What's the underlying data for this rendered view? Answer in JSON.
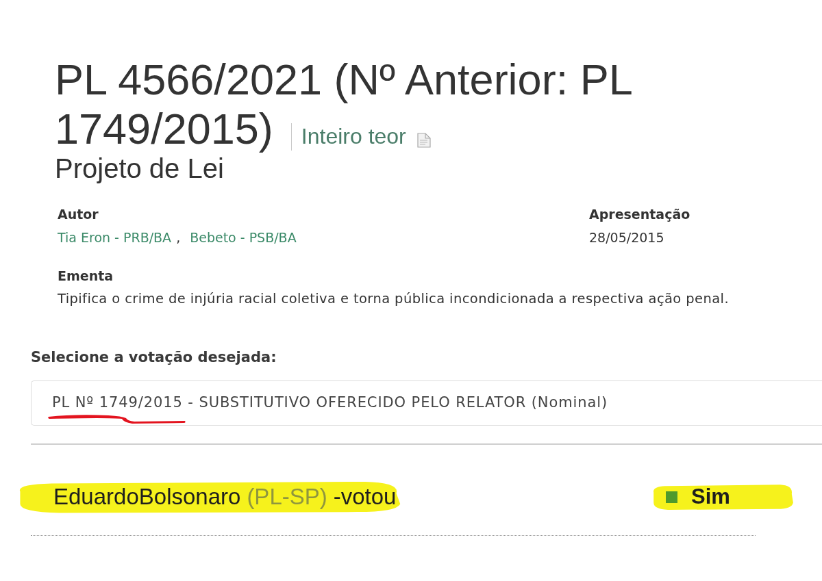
{
  "title_lines": [
    "PL 4566/2021 (Nº Anterior: PL",
    "1749/2015)"
  ],
  "full_text_link": {
    "label": "Inteiro teor"
  },
  "proposal_type": "Projeto de Lei",
  "author": {
    "label": "Autor",
    "names": [
      "Tia Eron - PRB/BA",
      "Bebeto - PSB/BA"
    ],
    "separator": ","
  },
  "presentation": {
    "label": "Apresentação",
    "date": "28/05/2015"
  },
  "summary": {
    "label": "Ementa",
    "text": "Tipifica o crime de injúria racial coletiva e torna pública incondicionada a respectiva ação penal."
  },
  "vote_select": {
    "label": "Selecione a votação desejada:",
    "value": "PL Nº 1749/2015 - SUBSTITUTIVO OFERECIDO PELO RELATOR (Nominal)",
    "underlined": true
  },
  "vote": {
    "deputy": "EduardoBolsonaro",
    "party": "(PL-SP)",
    "verb": "-votou",
    "choice": "Sim",
    "color": "#4f9a2c",
    "highlighted": true
  }
}
